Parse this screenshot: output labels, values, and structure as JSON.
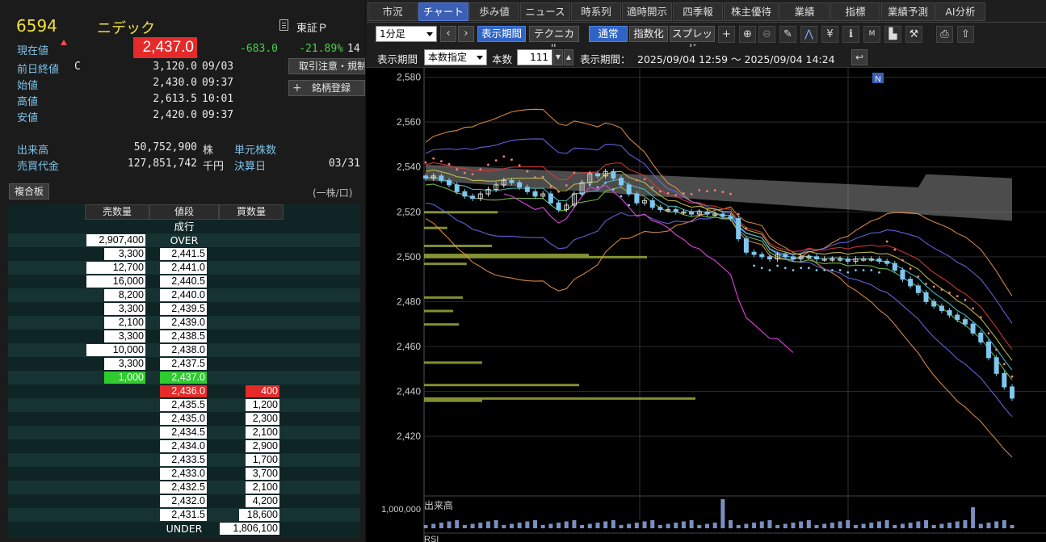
{
  "quote": {
    "code": "6594",
    "name": "ニデック",
    "market": "東証Ｐ",
    "price_label": "現在値",
    "price": "2,437.0",
    "change": "-683.0",
    "change_pct": "-21.89%",
    "time_trunc": "14",
    "rows": [
      {
        "label": "前日終値",
        "flag": "C",
        "value": "3,120.0",
        "time": "09/03"
      },
      {
        "label": "始値",
        "flag": "",
        "value": "2,430.0",
        "time": "09:37"
      },
      {
        "label": "高値",
        "flag": "",
        "value": "2,613.5",
        "time": "10:01"
      },
      {
        "label": "安値",
        "flag": "",
        "value": "2,420.0",
        "time": "09:37"
      }
    ],
    "volume_label": "出来高",
    "volume": "50,752,900",
    "volume_unit": "株",
    "turnover_label": "売買代金",
    "turnover": "127,851,742",
    "turnover_unit": "千円",
    "unit_shares_label": "単元株数",
    "settle_label": "決算日",
    "settle_value": "03/31",
    "btn_caution": "取引注意・規制",
    "btn_register": "銘柄登録"
  },
  "board": {
    "tab": "複合板",
    "unit_note": "(一株/口)",
    "headers": [
      "売数量",
      "値段",
      "買数量"
    ],
    "market_order": "成行",
    "over_qty": "2,907,400",
    "over": "OVER",
    "asks": [
      {
        "qty": "3,300",
        "price": "2,441.5"
      },
      {
        "qty": "12,700",
        "price": "2,441.0"
      },
      {
        "qty": "16,000",
        "price": "2,440.5"
      },
      {
        "qty": "8,200",
        "price": "2,440.0"
      },
      {
        "qty": "3,300",
        "price": "2,439.5"
      },
      {
        "qty": "2,100",
        "price": "2,439.0"
      },
      {
        "qty": "3,300",
        "price": "2,438.5"
      },
      {
        "qty": "10,000",
        "price": "2,438.0"
      },
      {
        "qty": "3,300",
        "price": "2,437.5"
      },
      {
        "qty": "1,000",
        "price": "2,437.0"
      }
    ],
    "bids": [
      {
        "price": "2,436.0",
        "qty": "400"
      },
      {
        "price": "2,435.5",
        "qty": "1,200"
      },
      {
        "price": "2,435.0",
        "qty": "2,300"
      },
      {
        "price": "2,434.5",
        "qty": "2,100"
      },
      {
        "price": "2,434.0",
        "qty": "2,900"
      },
      {
        "price": "2,433.5",
        "qty": "1,700"
      },
      {
        "price": "2,433.0",
        "qty": "3,700"
      },
      {
        "price": "2,432.5",
        "qty": "2,100"
      },
      {
        "price": "2,432.0",
        "qty": "4,200"
      },
      {
        "price": "2,431.5",
        "qty": "18,600"
      }
    ],
    "under": "UNDER",
    "under_qty": "1,806,100"
  },
  "tabs": [
    "市況",
    "チャート",
    "歩み値",
    "ニュース",
    "時系列",
    "適時開示",
    "四季報",
    "株主優待",
    "業績",
    "指標",
    "業績予測",
    "AI分析"
  ],
  "toolbar": {
    "interval": "1分足",
    "period_btn": "表示期間",
    "technical_btn": "テクニカル",
    "normal_btn": "通常",
    "index_btn": "指数化",
    "spread_btn": "スプレッド",
    "period_label": "表示期間",
    "period_mode": "本数指定",
    "count_label": "本数",
    "count": "111",
    "range_label": "表示期間：",
    "range": "2025/09/04 12:59 ～ 2025/09/04 14:24"
  },
  "chart_data": {
    "type": "line",
    "yticks": [
      "2,580",
      "2,560",
      "2,540",
      "2,520",
      "2,500",
      "2,480",
      "2,460",
      "2,440",
      "2,420"
    ],
    "ylim": [
      2415,
      2582
    ],
    "news_marker": "N",
    "volume_label": "出来高",
    "volume_tick": "1,000,000",
    "lower_label": "RSI",
    "close_series": [
      2535,
      2536,
      2534,
      2532,
      2529,
      2527,
      2526,
      2528,
      2530,
      2532,
      2534,
      2533,
      2531,
      2529,
      2527,
      2528,
      2524,
      2521,
      2523,
      2528,
      2533,
      2537,
      2536,
      2538,
      2535,
      2532,
      2528,
      2524,
      2525,
      2522,
      2521,
      2521,
      2520,
      2520,
      2519,
      2520,
      2519,
      2519,
      2518,
      2517,
      2508,
      2502,
      2501,
      2500,
      2499,
      2501,
      2500,
      2499,
      2500,
      2500,
      2499,
      2499,
      2499,
      2499,
      2498,
      2499,
      2499,
      2499,
      2498,
      2497,
      2494,
      2490,
      2487,
      2484,
      2480,
      2478,
      2476,
      2474,
      2472,
      2470,
      2466,
      2462,
      2455,
      2448,
      2442,
      2437
    ],
    "colors": {
      "up": "#d9d9d9",
      "down": "#7fc7ef",
      "sar": "#f08080",
      "cloud": "#8a8a8a"
    }
  }
}
